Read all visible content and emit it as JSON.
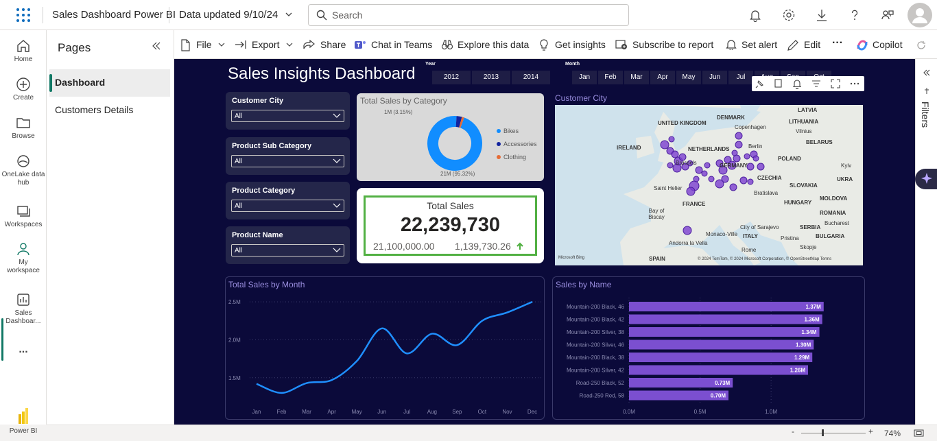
{
  "app": {
    "title": "Sales Dashboard Power BI",
    "data_updated": "Data updated 9/10/24"
  },
  "search": {
    "placeholder": "Search"
  },
  "leftrail": {
    "items": [
      {
        "label": "Home"
      },
      {
        "label": "Create"
      },
      {
        "label": "Browse"
      },
      {
        "label": "OneLake data hub"
      },
      {
        "label": "Workspaces"
      },
      {
        "label": "My workspace"
      },
      {
        "label": "Sales Dashboar..."
      },
      {
        "label": "..."
      },
      {
        "label": "Power BI"
      }
    ]
  },
  "pages": {
    "title": "Pages",
    "items": [
      "Dashboard",
      "Customers Details"
    ]
  },
  "toolbar": {
    "items": [
      "File",
      "Export",
      "Share",
      "Chat in Teams",
      "Explore this data",
      "Get insights",
      "Subscribe to report",
      "Set alert",
      "Edit",
      "···",
      "Copilot"
    ]
  },
  "filters": {
    "label": "Filters"
  },
  "status": {
    "zoom": "74%"
  },
  "dashboard": {
    "title": "Sales Insights Dashboard",
    "year_slicer": {
      "label": "Year",
      "options": [
        "2012",
        "2013",
        "2014"
      ]
    },
    "month_slicer": {
      "label": "Month",
      "options": [
        "Jan",
        "Feb",
        "Mar",
        "Apr",
        "May",
        "Jun",
        "Jul",
        "Aug",
        "Sep",
        "Oct"
      ]
    },
    "dropdowns": [
      {
        "label": "Customer City",
        "value": "All"
      },
      {
        "label": "Product Sub Category",
        "value": "All"
      },
      {
        "label": "Product Category",
        "value": "All"
      },
      {
        "label": "Product Name",
        "value": "All"
      }
    ],
    "donut": {
      "title": "Total Sales by Category",
      "top_label": "1M (3.15%)",
      "bottom_label": "21M (95.32%)",
      "legend": [
        "Bikes",
        "Accessories",
        "Clothing"
      ]
    },
    "kpi": {
      "title": "Total Sales",
      "value": "22,239,730",
      "goal": "21,100,000.00",
      "diff": "1,139,730.26"
    },
    "map": {
      "title": "Customer City",
      "labels": [
        "UNITED KINGDOM",
        "DENMARK",
        "Copenhagen",
        "LATVIA",
        "LITHUANIA",
        "Vilnius",
        "BELARUS",
        "IRELAND",
        "NETHERLANDS",
        "Berlin",
        "POLAND",
        "Brussels",
        "GERMANY",
        "CZECHIA",
        "Kyiv",
        "UKRA",
        "Saint Helier",
        "SLOVAKIA",
        "MOLDOVA",
        "FRANCE",
        "Bratislava",
        "HUNGARY",
        "Bay of Biscay",
        "ROMANIA",
        "Bucharest",
        "City of Sarajevo",
        "SERBIA",
        "Andorra la Vella",
        "Monaco-Ville",
        "ITALY",
        "Pristina",
        "BULGARIA",
        "Rome",
        "Skopje",
        "SPAIN",
        "Microsoft Bing",
        "© 2024 TomTom, © 2024 Microsoft Corporation, © OpenStreetMap  Terms"
      ]
    },
    "line_title": "Total Sales by Month",
    "bar_title": "Sales by Name"
  },
  "chart_data": [
    {
      "type": "line",
      "title": "Total Sales by Month",
      "categories": [
        "Jan",
        "Feb",
        "Mar",
        "Apr",
        "May",
        "Jun",
        "Jul",
        "Aug",
        "Sep",
        "Oct",
        "Nov",
        "Dec"
      ],
      "values": [
        1.42,
        1.3,
        1.43,
        1.47,
        1.72,
        2.15,
        1.82,
        2.08,
        1.93,
        2.25,
        2.36,
        2.5
      ],
      "y_ticks": [
        "1.5M",
        "2.0M",
        "2.5M"
      ],
      "ylim": [
        1.2,
        2.6
      ],
      "color": "#1f8fff"
    },
    {
      "type": "bar",
      "title": "Sales by Name",
      "categories": [
        "Mountain-200 Black, 46",
        "Mountain-200 Black, 42",
        "Mountain-200 Silver, 38",
        "Mountain-200 Silver, 46",
        "Mountain-200 Black, 38",
        "Mountain-200 Silver, 42",
        "Road-250 Black, 52",
        "Road-250 Red, 58"
      ],
      "values": [
        1.37,
        1.36,
        1.34,
        1.3,
        1.29,
        1.26,
        0.73,
        0.7
      ],
      "labels": [
        "1.37M",
        "1.36M",
        "1.34M",
        "1.30M",
        "1.29M",
        "1.26M",
        "0.73M",
        "0.70M"
      ],
      "x_ticks": [
        "0.0M",
        "0.5M",
        "1.0M"
      ],
      "xlim": [
        0,
        1.4
      ],
      "color": "#7b4fd0"
    },
    {
      "type": "pie",
      "title": "Total Sales by Category",
      "categories": [
        "Bikes",
        "Accessories",
        "Clothing"
      ],
      "values": [
        95.32,
        3.15,
        1.53
      ],
      "colors": [
        "#118dff",
        "#12239e",
        "#e66c37"
      ]
    }
  ]
}
